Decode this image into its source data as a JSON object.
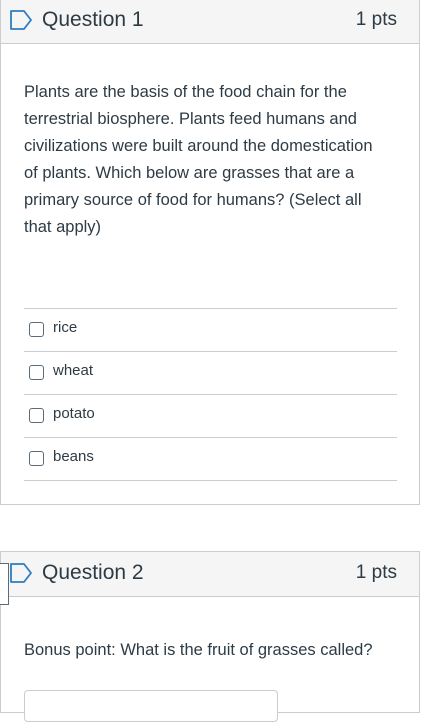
{
  "questions": [
    {
      "title": "Question 1",
      "points": "1 pts",
      "text": "Plants are the basis of the food chain for the terrestrial biosphere. Plants feed humans and civilizations were built around the domestication of plants. Which below are grasses that are a primary source of food for humans? (Select all that apply)",
      "answers": [
        "rice",
        "wheat",
        "potato",
        "beans"
      ]
    },
    {
      "title": "Question 2",
      "points": "1 pts",
      "text": "Bonus point: What is the fruit of grasses called?"
    }
  ],
  "icons": {
    "flag": "flag-outline-icon"
  },
  "colors": {
    "flag": "#2d7cc2",
    "text": "#2d3b45",
    "border": "#c7cdd1",
    "header_bg": "#f5f5f5"
  }
}
